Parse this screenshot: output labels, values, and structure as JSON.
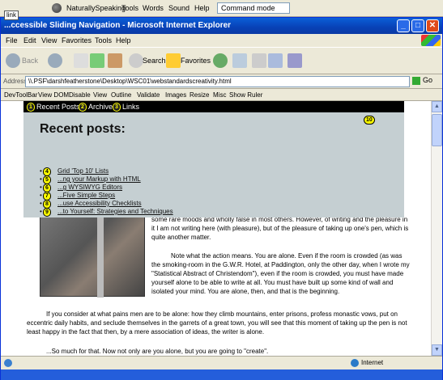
{
  "naturallyspeaking": {
    "app_name": "NaturallySpeaking",
    "menu": [
      "Tools",
      "Words",
      "Sound",
      "Help"
    ],
    "mode": "Command mode"
  },
  "link_tooltip": "link",
  "window": {
    "title": "...ccessible Sliding Navigation - Microsoft Internet Explorer",
    "controls": [
      "_",
      "□",
      "✕"
    ]
  },
  "menubar": [
    "File",
    "Edit",
    "View",
    "Favorites",
    "Tools",
    "Help"
  ],
  "toolbar": {
    "back_label": "Back",
    "search_label": "Search",
    "favorites_label": "Favorites"
  },
  "address": {
    "label": "Address",
    "value": "\\\\.PSF\\darshfeatherstone\\Desktop\\WSC01\\webstandardscreativity.html",
    "go_label": "Go"
  },
  "devtoolbar": [
    "DevToolBar",
    "View DOM",
    "Disable",
    "View",
    "Outline",
    "Validate",
    "Images",
    "Resize",
    "Misc",
    "Show Ruler"
  ],
  "nav": {
    "items": [
      "Recent Posts",
      "Archives",
      "Links"
    ],
    "badges": [
      "1",
      "2",
      "3"
    ]
  },
  "panel": {
    "heading": "Recent posts:",
    "close_badge": "10",
    "posts": [
      {
        "badge": "4",
        "label": "Grid 'Top 10' Lists"
      },
      {
        "badge": "5",
        "label": "...ng your Markup with HTML"
      },
      {
        "badge": "6",
        "label": "...g WYSIWYG Editors"
      },
      {
        "badge": "7",
        "label": "...Five Simple Steps"
      },
      {
        "badge": "8",
        "label": "...use Accessibility Checklists"
      },
      {
        "badge": "9",
        "label": "...to Yourself: Strategies and Techniques"
      }
    ]
  },
  "article": {
    "p1": "some rare moods and wholly false in most others. However, of writing and the pleasure in it I am not writing here (with pleasure), but of the pleasure of taking up one's pen, which is quite another matter.",
    "p2": "Note what the action means. You are alone. Even if the room is crowded (as was the smoking-room in the G.W.R. Hotel, at Paddington, only the other day, when I wrote my \"Statistical Abstract of Christendom\"), even if the room is crowded, you must have made yourself alone to be able to write at all. You must have built up some kind of wall and isolated your mind. You are alone, then, and that is the beginning.",
    "p3": "If you consider at what pains men are to be alone: how they climb mountains, enter prisons, profess monastic vows, put on eccentric daily habits, and seclude themselves in the garrets of a great town, you will see that this moment of taking up the pen is not least happy in the fact that then, by a mere association of ideas, the writer is alone.",
    "p4": "...So much for that. Now not only are you alone, but you are going to \"create\"."
  },
  "status": {
    "zone": "Internet"
  }
}
